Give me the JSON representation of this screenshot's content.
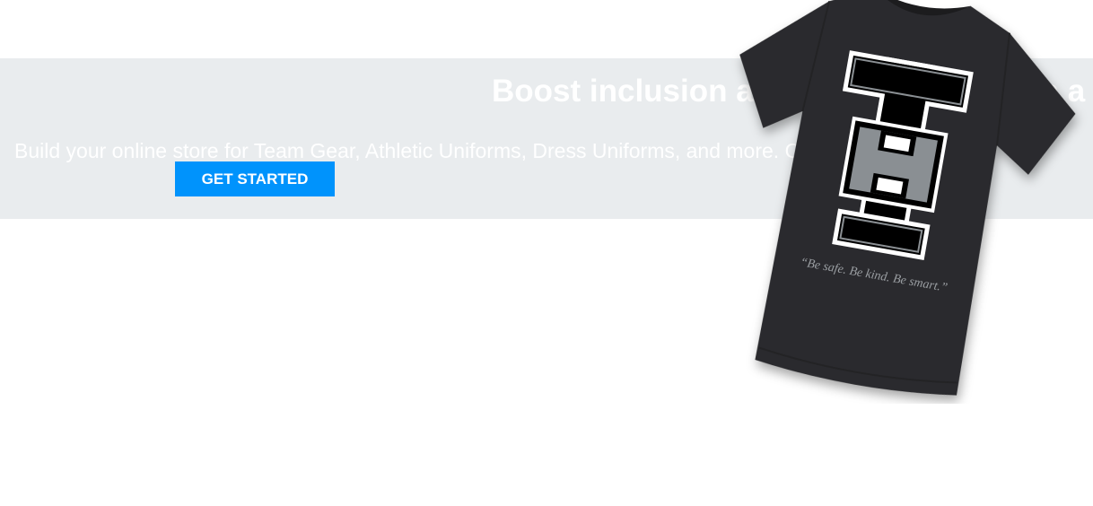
{
  "hero": {
    "headline": "Boost inclusion and school spirit with a custom",
    "subtitle": "Build your online store for Team Gear, Athletic Uniforms, Dress Uniforms, and more. Open 24/7/365",
    "cta_label": "GET STARTED"
  },
  "product_image": {
    "shirt_color": "#2b2b2d",
    "logo_letters": [
      "T",
      "H",
      "I"
    ],
    "tagline": "“Be safe. Be kind. Be smart.”"
  },
  "colors": {
    "band_background": "#e9ecee",
    "cta_background": "#0093fc",
    "cta_text": "#ffffff"
  }
}
